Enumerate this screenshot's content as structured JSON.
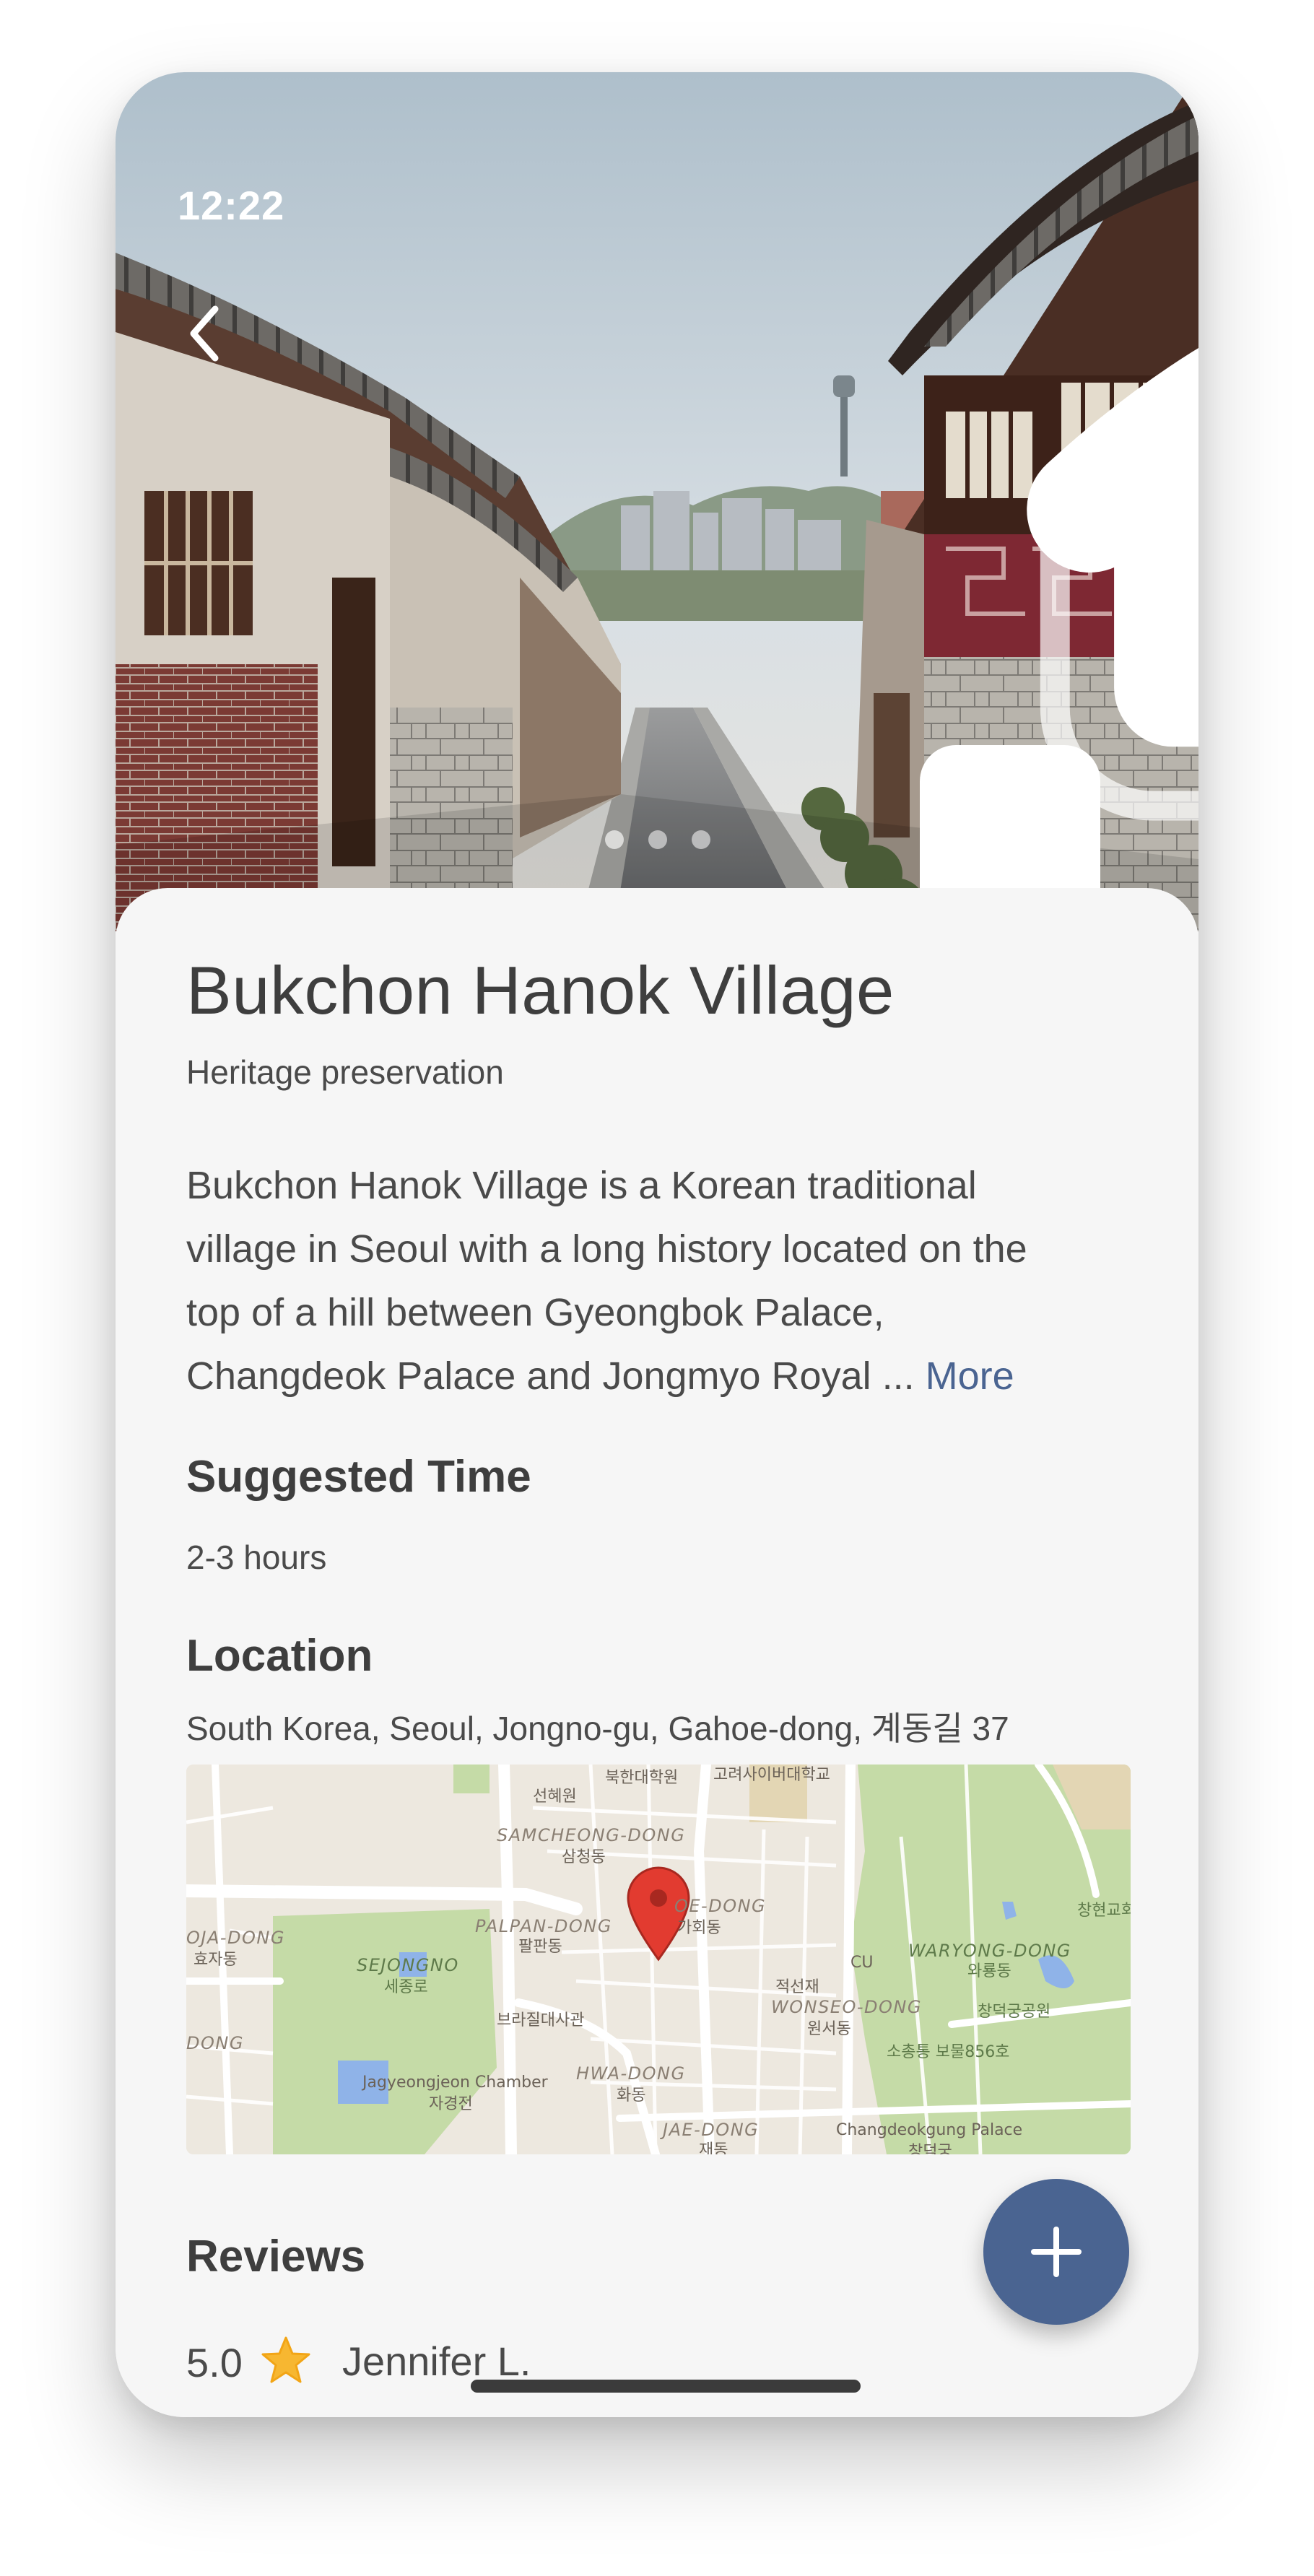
{
  "status_bar": {
    "time": "12:22",
    "signal_icon": "cellular-signal-icon",
    "wifi_icon": "wifi-icon",
    "battery_icon": "battery-icon"
  },
  "header": {
    "back_icon": "chevron-left-icon",
    "carousel_pages": 3,
    "carousel_active_index": 0
  },
  "place": {
    "title": "Bukchon Hanok Village",
    "category": "Heritage preservation",
    "description_lines": [
      "Bukchon Hanok Village is a Korean traditional",
      "village in Seoul with a long history located on the",
      "top of a hill between Gyeongbok Palace,",
      "Changdeok Palace and Jongmyo Royal ..."
    ],
    "more_label": "More"
  },
  "suggested_time": {
    "heading": "Suggested Time",
    "value": "2-3 hours"
  },
  "location": {
    "heading": "Location",
    "address": "South Korea, Seoul, Jongno-gu, Gahoe-dong, 계동길 37",
    "map_labels": [
      "북한대학원",
      "고려사이버대학교",
      "선혜원",
      "SAMCHEONG-DONG",
      "삼청동",
      "PALPAN-DONG",
      "팔판동",
      "OE-DONG",
      "가회동",
      "OJA-DONG",
      "효자동",
      "SEJONGNO",
      "세종로",
      "브라질대사관",
      "CU",
      "적선재",
      "WONSEO-DONG",
      "원서동",
      "WARYONG-DONG",
      "와룡동",
      "창덕궁공원",
      "창현교회",
      "소총통 보물856호",
      "Jagyeongjeon Chamber",
      "자경전",
      "HWA-DONG",
      "화동",
      "DONG",
      "JAE-DONG",
      "재동",
      "Changdeokgung Palace",
      "창덕궁"
    ],
    "pin_icon": "map-pin-icon",
    "colors": {
      "park": "#c5dba7",
      "road": "#ffffff",
      "land": "#ede8df",
      "water": "#8fb3e8",
      "pin": "#e23b30"
    }
  },
  "reviews": {
    "heading": "Reviews",
    "rating": "5.0",
    "star_icon": "star-icon",
    "reviewer": "Jennifer L."
  },
  "fab": {
    "icon": "plus-icon"
  },
  "colors": {
    "accent": "#4a6491",
    "text": "#4a4a4a",
    "star": "#f7b731"
  }
}
